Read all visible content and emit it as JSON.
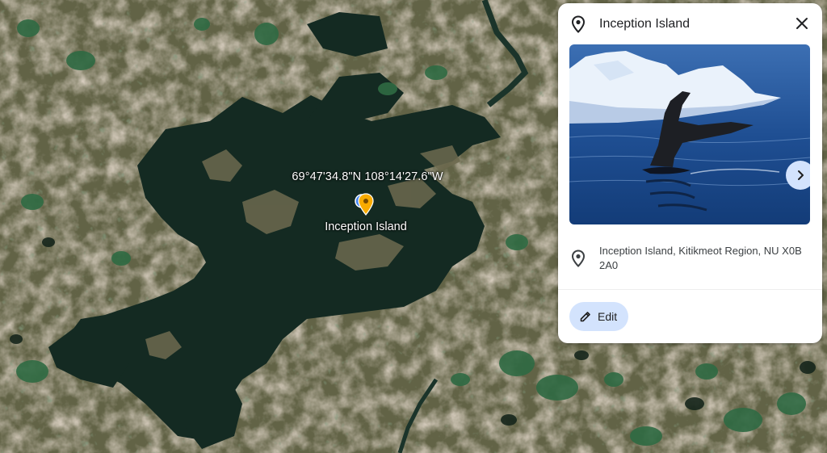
{
  "map": {
    "coordinates": "69°47'34.8\"N 108°14'27.6\"W",
    "place_label": "Inception Island"
  },
  "card": {
    "title": "Inception Island",
    "address": "Inception Island, Kitikmeot Region, NU X0B 2A0",
    "edit_label": "Edit"
  },
  "colors": {
    "accent_button": "#d3e3fd",
    "pin_yellow": "#f9ab00",
    "pin_blue": "#4285f4",
    "water": "#13261e",
    "land": "#6f6a4c"
  }
}
